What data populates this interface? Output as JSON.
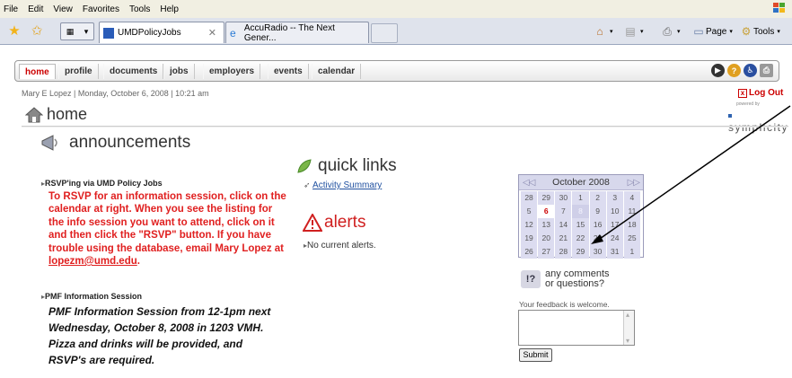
{
  "menubar": {
    "items": [
      "File",
      "Edit",
      "View",
      "Favorites",
      "Tools",
      "Help"
    ]
  },
  "tabs": [
    {
      "label": "UMDPolicyJobs",
      "active": true
    },
    {
      "label": "AccuRadio -- The Next Gener...",
      "active": false
    }
  ],
  "toolbar": {
    "page_label": "Page",
    "tools_label": "Tools"
  },
  "nav": {
    "tabs": [
      "home",
      "profile",
      "documents",
      "jobs",
      "employers",
      "events",
      "calendar"
    ]
  },
  "header": {
    "userline": "Mary E Lopez | Monday, October 6, 2008 | 10:21 am",
    "logout": "Log Out",
    "powered_by": "powered by",
    "brand": "symplicity",
    "page_title": "home"
  },
  "announcements": {
    "title": "announcements",
    "items": [
      {
        "title": "RSVP'ing via UMD Policy Jobs",
        "body": "To RSVP for an information session, click on the calendar at right. When you see the listing for the info session you want to attend, click on it and then click the \"RSVP\" button. If you have trouble using the database, email Mary Lopez at ",
        "email": "lopezm@umd.edu",
        "tail": "."
      },
      {
        "title": "PMF Information Session",
        "body": "PMF Information Session from 12-1pm next Wednesday, October 8, 2008 in 1203 VMH. Pizza and drinks will be provided, and RSVP's are required."
      }
    ]
  },
  "quick_links": {
    "title": "quick links",
    "items": [
      "Activity Summary"
    ]
  },
  "alerts": {
    "title": "alerts",
    "empty": "No current alerts."
  },
  "calendar": {
    "month": "October 2008",
    "today": "6",
    "selected": "8",
    "days": [
      "28",
      "29",
      "30",
      "1",
      "2",
      "3",
      "4",
      "5",
      "6",
      "7",
      "8",
      "9",
      "10",
      "11",
      "12",
      "13",
      "14",
      "15",
      "16",
      "17",
      "18",
      "19",
      "20",
      "21",
      "22",
      "23",
      "24",
      "25",
      "26",
      "27",
      "28",
      "29",
      "30",
      "31",
      "1"
    ]
  },
  "feedback": {
    "title_line1": "any comments",
    "title_line2": "or questions?",
    "welcome": "Your feedback is welcome.",
    "submit": "Submit"
  }
}
